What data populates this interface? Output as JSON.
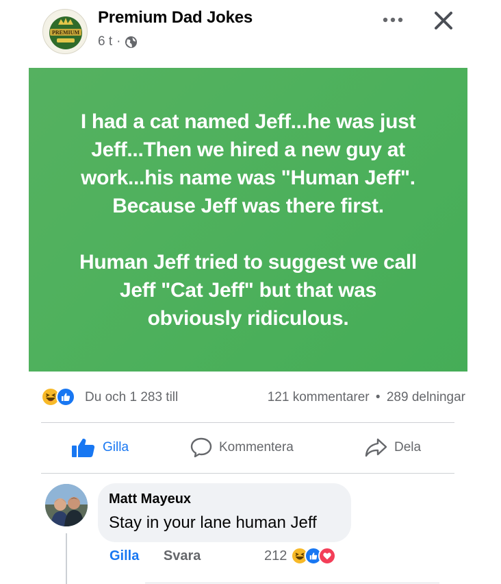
{
  "post": {
    "page_name": "Premium Dad Jokes",
    "time": "6 t",
    "separator": "·",
    "privacy_icon": "globe-icon",
    "logo_text": "PREMIUM",
    "more_icon": "more-horizontal-icon",
    "close_icon": "close-icon",
    "image_text": {
      "paragraph1": "I had a cat named Jeff...he was just\nJeff...Then we hired a new guy at\nwork...his name was \"Human Jeff\".\nBecause Jeff was there first.",
      "paragraph2": "Human Jeff tried to suggest we call\nJeff \"Cat Jeff\" but that was\nobviously ridiculous."
    },
    "image_bg": "#4fb15d"
  },
  "stats": {
    "reaction_icons": [
      "haha-icon",
      "like-icon"
    ],
    "reactors": "Du och 1 283 till",
    "comments": "121 kommentarer",
    "dot": "•",
    "shares": "289 delningar"
  },
  "actions": {
    "like": "Gilla",
    "comment": "Kommentera",
    "share": "Dela"
  },
  "comment": {
    "author": "Matt Mayeux",
    "text": "Stay in your lane human Jeff",
    "like": "Gilla",
    "reply": "Svara",
    "reaction_count": "212",
    "reaction_icons": [
      "haha-icon",
      "like-icon",
      "love-icon"
    ]
  },
  "colors": {
    "facebook_blue": "#1877f2",
    "secondary_text": "#65676b",
    "love_red": "#f33e58",
    "haha_yellow": "#f7b928"
  }
}
